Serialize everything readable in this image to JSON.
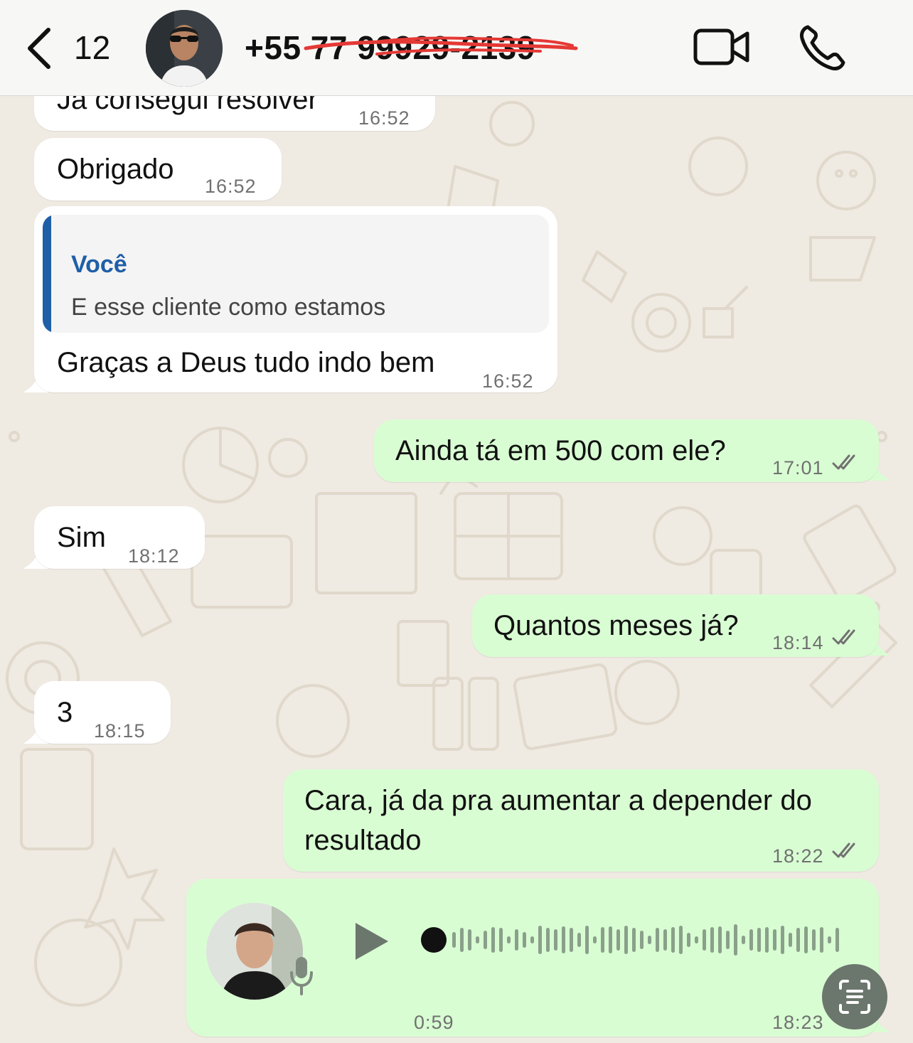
{
  "header": {
    "back_count": "12",
    "contact_name": "+55 77 99929-2139"
  },
  "messages": [
    {
      "text": "Já consegui resolver",
      "time": "16:52"
    },
    {
      "text": "Obrigado",
      "time": "16:52"
    },
    {
      "quote_author": "Você",
      "quote_text": "E esse cliente como estamos",
      "text": "Graças a Deus tudo indo bem",
      "time": "16:52"
    },
    {
      "text": "Ainda tá em 500 com ele?",
      "time": "17:01"
    },
    {
      "text": "Sim",
      "time": "18:12"
    },
    {
      "text": "Quantos meses já?",
      "time": "18:14"
    },
    {
      "text": "3",
      "time": "18:15"
    },
    {
      "text_line1": "Cara, já da pra aumentar a depender do",
      "text_line2": "resultado",
      "time": "18:22"
    },
    {
      "duration": "0:59",
      "time": "18:23",
      "progress": 0
    }
  ],
  "colors": {
    "incoming": "#ffffff",
    "outgoing": "#d9fdd3",
    "accent": "#1e5fa8",
    "wallpaper": "#efeae2",
    "read_ticks": "#717171"
  },
  "icons": [
    "chevron-left-icon",
    "video-camera-icon",
    "phone-icon",
    "play-icon",
    "microphone-icon",
    "double-check-icon",
    "scan-text-icon"
  ]
}
